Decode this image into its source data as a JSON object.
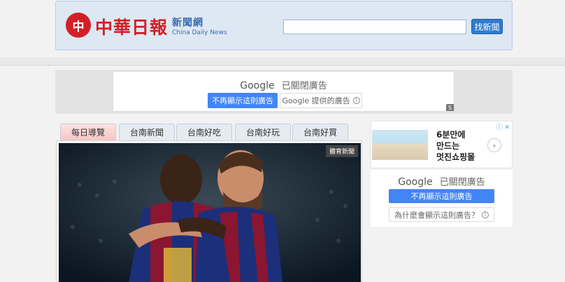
{
  "header": {
    "logo_mark": "中",
    "logo_title": "中華日報",
    "logo_sub": "新聞網",
    "logo_sub_en": "China Daily News",
    "search_value": "",
    "search_button": "找新聞"
  },
  "top_ad": {
    "google_label": "Google",
    "closed_label": "已關閉廣告",
    "stop_button": "不再顯示這則廣告",
    "provided_button": "Google 提供的廣告",
    "s_badge": "S"
  },
  "tabs": [
    "每日導覽",
    "台南新聞",
    "台南好吃",
    "台南好玩",
    "台南好買"
  ],
  "hero": {
    "badge": "體育新聞"
  },
  "side_ad": {
    "line1": "6분만에",
    "line2": "만드는",
    "line3": "멋진쇼핑몰",
    "adchoice": "ⓘ ✕"
  },
  "side_closed": {
    "google_label": "Google",
    "closed_label": "已關閉廣告",
    "stop_button": "不再顯示這則廣告",
    "why_button": "為什麼會顯示這則廣告？"
  }
}
